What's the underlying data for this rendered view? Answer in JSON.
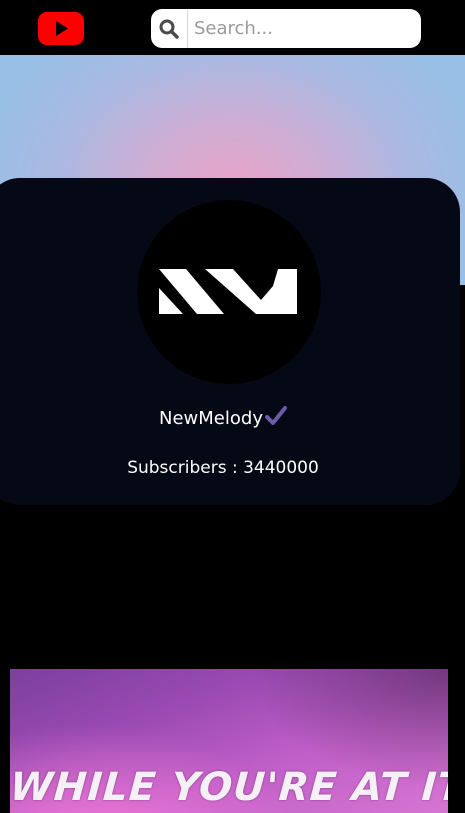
{
  "header": {
    "logo_icon": "youtube-logo-icon",
    "search": {
      "placeholder": "Search...",
      "value": "",
      "icon": "search-icon"
    }
  },
  "channel": {
    "name": "NewMelody",
    "verified_icon": "check-icon",
    "subscribers_text": "Subscribers : 3440000",
    "avatar_icon": "newmelody-logo-icon"
  },
  "video": {
    "thumbnail_title": "WHILE YOU'RE AT IT"
  },
  "colors": {
    "youtube_red": "#ff0000",
    "card_bg": "#050915",
    "check": "#6e5aa8",
    "banner_center": "#eaa3c7",
    "banner_edge": "#98bfe6"
  }
}
